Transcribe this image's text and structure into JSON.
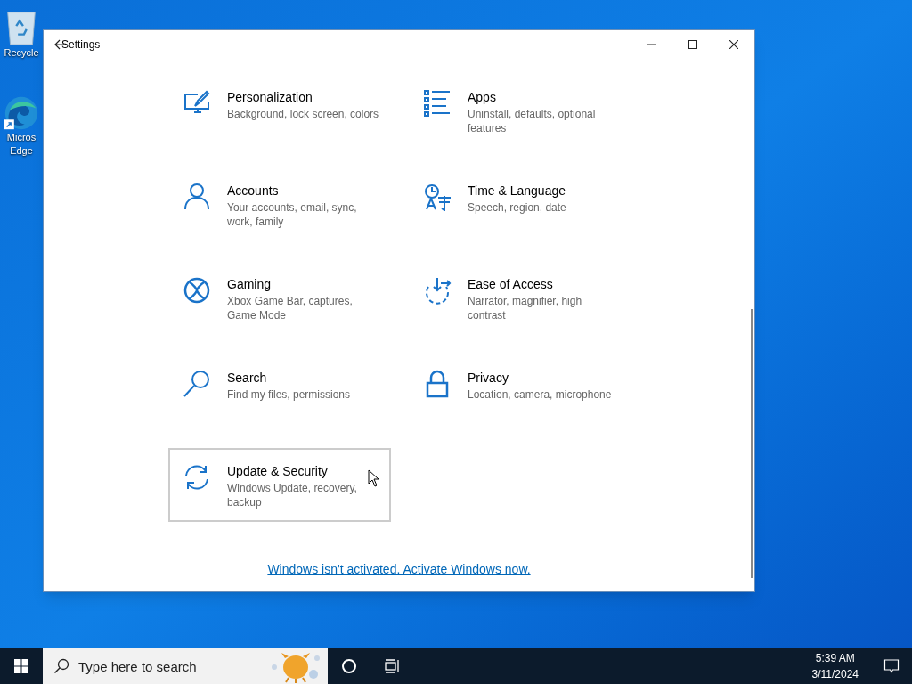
{
  "desktop_icons": [
    {
      "label": [
        "Recycle"
      ]
    },
    {
      "label": [
        "Micros",
        "Edge"
      ]
    }
  ],
  "window": {
    "title": "Settings"
  },
  "categories": [
    {
      "title": "Personalization",
      "subtitle": "Background, lock screen, colors",
      "hovered": false
    },
    {
      "title": "Apps",
      "subtitle": "Uninstall, defaults, optional features",
      "hovered": false
    },
    {
      "title": "Accounts",
      "subtitle": "Your accounts, email, sync, work, family",
      "hovered": false
    },
    {
      "title": "Time & Language",
      "subtitle": "Speech, region, date",
      "hovered": false
    },
    {
      "title": "Gaming",
      "subtitle": "Xbox Game Bar, captures, Game Mode",
      "hovered": false
    },
    {
      "title": "Ease of Access",
      "subtitle": "Narrator, magnifier, high contrast",
      "hovered": false
    },
    {
      "title": "Search",
      "subtitle": "Find my files, permissions",
      "hovered": false
    },
    {
      "title": "Privacy",
      "subtitle": "Location, camera, microphone",
      "hovered": false
    },
    {
      "title": "Update & Security",
      "subtitle": "Windows Update, recovery, backup",
      "hovered": true
    }
  ],
  "activation_link": "Windows isn't activated. Activate Windows now.",
  "taskbar": {
    "search": {
      "placeholder": "Type here to search"
    },
    "time": "5:39 AM",
    "date": "3/11/2024"
  }
}
